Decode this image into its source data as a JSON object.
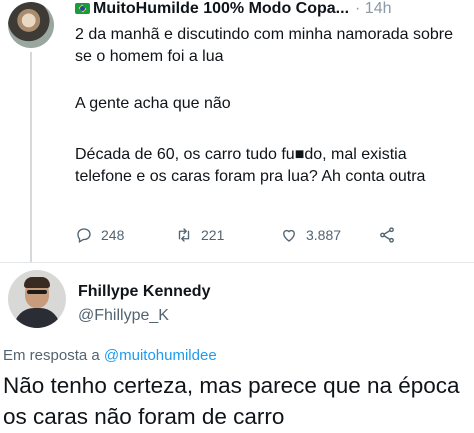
{
  "tweet": {
    "display_name": "MuitoHumilde 100% Modo Copa...",
    "separator": "·",
    "time": "14h",
    "text_line_1": "2 da manhã e discutindo com minha namorada sobre se o homem foi a lua",
    "text_line_2": "A gente acha que não",
    "text_line_3": "Década de 60, os carro tudo fu■do, mal existia telefone e os caras foram pra lua? Ah conta outra",
    "stats": {
      "replies": "248",
      "retweets": "221",
      "likes": "3.887"
    },
    "icons": [
      "flag-icon",
      "reply-icon",
      "retweet-icon",
      "like-icon",
      "share-icon"
    ]
  },
  "reply": {
    "display_name": "Fhillype Kennedy",
    "handle": "@Fhillype_K",
    "reply_prefix": "Em resposta a",
    "reply_mention": "@muitohumildee",
    "text": "Não tenho certeza, mas parece que na época os caras não foram de carro"
  },
  "colors": {
    "text": "#0f1419",
    "muted": "#536471",
    "link": "#1d9bf0",
    "divider": "#e4e7ea"
  }
}
